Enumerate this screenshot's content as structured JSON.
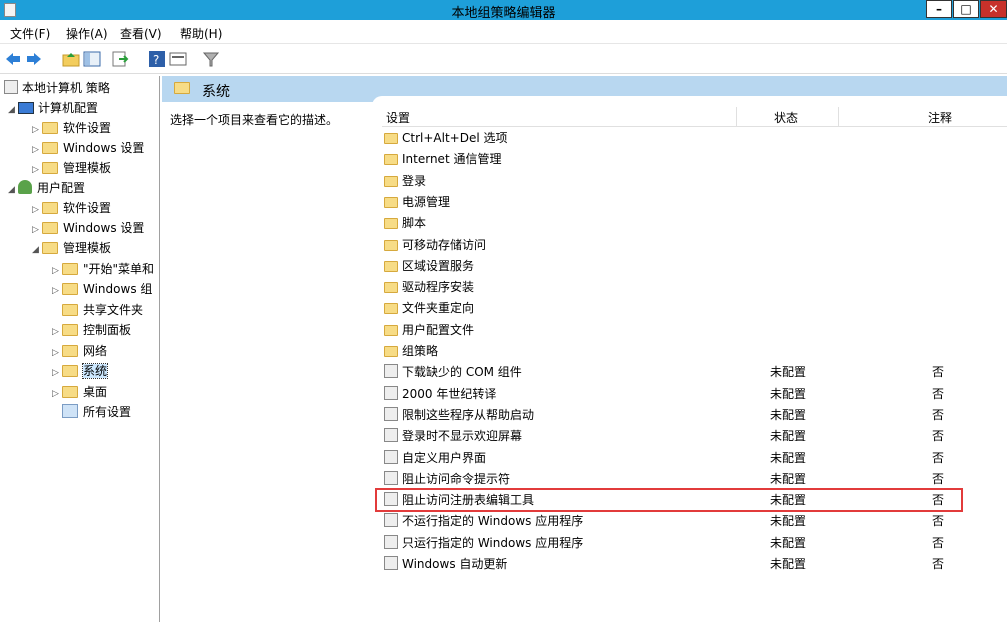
{
  "window": {
    "title": "本地组策略编辑器",
    "controls": [
      "–",
      "□",
      "✕"
    ]
  },
  "menu": [
    "文件(F)",
    "操作(A)",
    "查看(V)",
    "帮助(H)"
  ],
  "toolbar_icons": [
    "back-icon",
    "forward-icon",
    "up-folder-icon",
    "show-hide-tree-icon",
    "export-icon",
    "help-icon",
    "view-icon",
    "filter-icon"
  ],
  "tree": {
    "root": "本地计算机 策略",
    "computer_config": "计算机配置",
    "c_software": "软件设置",
    "c_windows": "Windows 设置",
    "c_templates": "管理模板",
    "user_config": "用户配置",
    "u_software": "软件设置",
    "u_windows": "Windows 设置",
    "u_templates": "管理模板",
    "start_menu": "\"开始\"菜单和",
    "windows_comp": "Windows 组",
    "shared": "共享文件夹",
    "control_panel": "控制面板",
    "network": "网络",
    "system": "系统",
    "desktop": "桌面",
    "all_settings": "所有设置"
  },
  "header": {
    "title": "系统"
  },
  "description": "选择一个项目来查看它的描述。",
  "columns": {
    "setting": "设置",
    "state": "状态",
    "note": "注释"
  },
  "folders": [
    "Ctrl+Alt+Del 选项",
    "Internet 通信管理",
    "登录",
    "电源管理",
    "脚本",
    "可移动存储访问",
    "区域设置服务",
    "驱动程序安装",
    "文件夹重定向",
    "用户配置文件",
    "组策略"
  ],
  "policies": [
    {
      "name": "下载缺少的 COM 组件",
      "state": "未配置",
      "note": "否"
    },
    {
      "name": "2000 年世纪转译",
      "state": "未配置",
      "note": "否"
    },
    {
      "name": "限制这些程序从帮助启动",
      "state": "未配置",
      "note": "否"
    },
    {
      "name": "登录时不显示欢迎屏幕",
      "state": "未配置",
      "note": "否"
    },
    {
      "name": "自定义用户界面",
      "state": "未配置",
      "note": "否"
    },
    {
      "name": "阻止访问命令提示符",
      "state": "未配置",
      "note": "否"
    },
    {
      "name": "阻止访问注册表编辑工具",
      "state": "未配置",
      "note": "否"
    },
    {
      "name": "不运行指定的 Windows 应用程序",
      "state": "未配置",
      "note": "否"
    },
    {
      "name": "只运行指定的 Windows 应用程序",
      "state": "未配置",
      "note": "否"
    },
    {
      "name": "Windows 自动更新",
      "state": "未配置",
      "note": "否"
    }
  ]
}
